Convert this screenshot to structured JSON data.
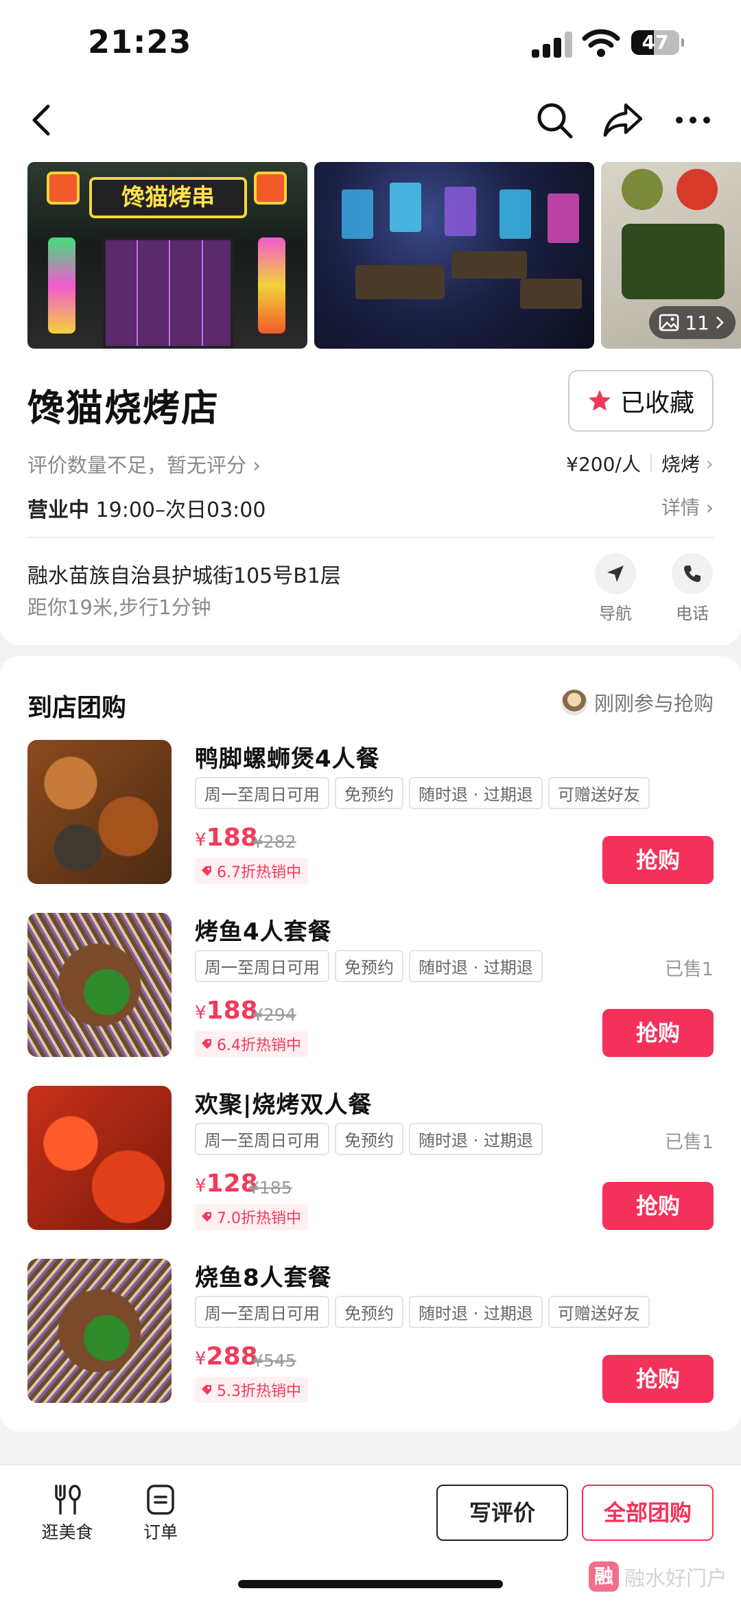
{
  "status_bar": {
    "time": "21:23",
    "battery": "47",
    "battery_level": 0.47
  },
  "gallery": {
    "photo_count": "11",
    "sign_text": "馋猫烤串"
  },
  "shop": {
    "name": "馋猫烧烤店",
    "collect_label": "已收藏",
    "rating_text": "评价数量不足，暂无评分",
    "price_per_person": "¥200/人",
    "category": "烧烤",
    "open_status": "营业中",
    "hours": "19:00–次日03:00",
    "detail_label": "详情",
    "address": "融水苗族自治县护城街105号B1层",
    "distance": "距你19米,步行1分钟",
    "navigate_label": "导航",
    "phone_label": "电话"
  },
  "group_buy": {
    "title": "到店团购",
    "recent_text": "刚刚参与抢购",
    "deals": [
      {
        "name": "鸭脚螺蛳煲4人餐",
        "tags": [
          "周一至周日可用",
          "免预约",
          "随时退 · 过期退",
          "可赠送好友"
        ],
        "sold": "",
        "price": "188",
        "original": "¥282",
        "discount": "6.7折热销中",
        "buy_label": "抢购"
      },
      {
        "name": "烤鱼4人套餐",
        "tags": [
          "周一至周日可用",
          "免预约",
          "随时退 · 过期退"
        ],
        "sold": "已售1",
        "price": "188",
        "original": "¥294",
        "discount": "6.4折热销中",
        "buy_label": "抢购"
      },
      {
        "name": "欢聚|烧烤双人餐",
        "tags": [
          "周一至周日可用",
          "免预约",
          "随时退 · 过期退"
        ],
        "sold": "已售1",
        "price": "128",
        "original": "¥185",
        "discount": "7.0折热销中",
        "buy_label": "抢购"
      },
      {
        "name": "烧鱼8人套餐",
        "tags": [
          "周一至周日可用",
          "免预约",
          "随时退 · 过期退",
          "可赠送好友"
        ],
        "sold": "",
        "price": "288",
        "original": "¥545",
        "discount": "5.3折热销中",
        "buy_label": "抢购"
      }
    ],
    "currency": "¥"
  },
  "bottom_bar": {
    "tab_food": "逛美食",
    "tab_orders": "订单",
    "write_review": "写评价",
    "all_deals": "全部团购",
    "watermark_text": "融水好门户",
    "watermark_logo": "融"
  },
  "colors": {
    "accent": "#f4315a",
    "price": "#f23a5a",
    "star": "#f0385a"
  }
}
